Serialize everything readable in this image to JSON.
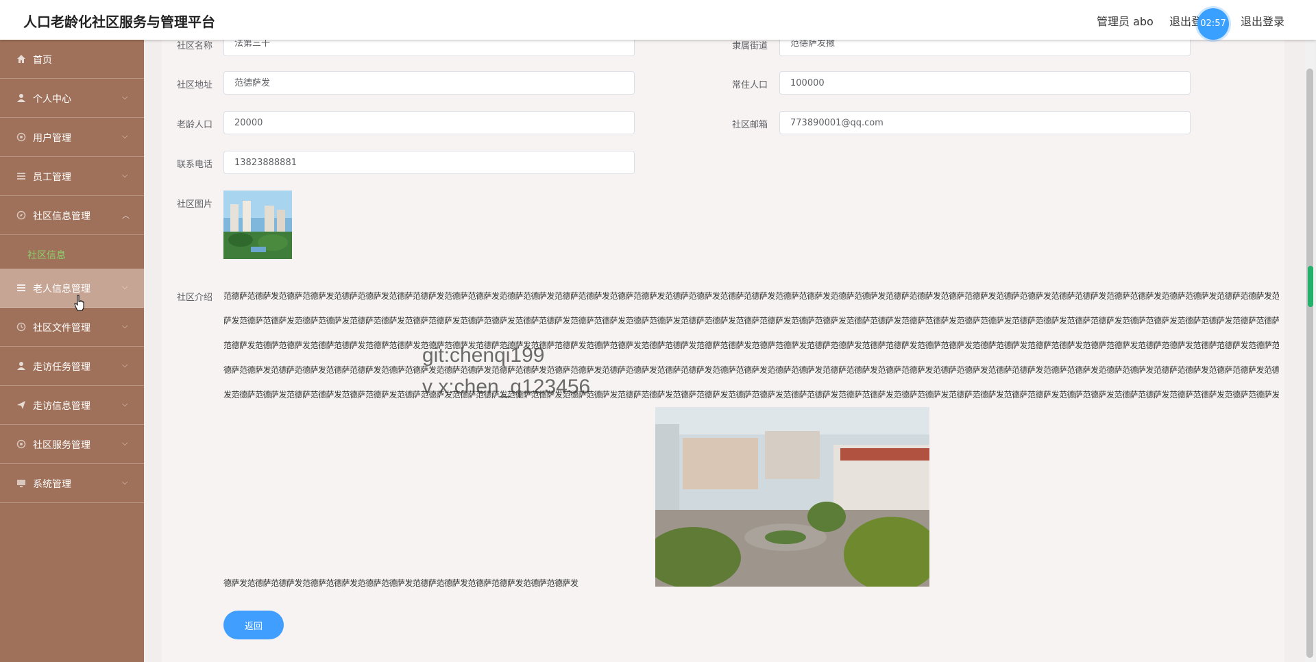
{
  "header": {
    "title": "人口老龄化社区服务与管理平台",
    "user": "管理员 abo",
    "logout_partial": "退出登",
    "timer": "02:57",
    "logout": "退出登录"
  },
  "sidebar": {
    "items": [
      {
        "label": "首页",
        "icon": "home-icon"
      },
      {
        "label": "个人中心",
        "icon": "user-icon"
      },
      {
        "label": "用户管理",
        "icon": "settings-icon"
      },
      {
        "label": "员工管理",
        "icon": "list-icon"
      },
      {
        "label": "社区信息管理",
        "icon": "compass-icon"
      },
      {
        "label": "老人信息管理",
        "icon": "menu-icon"
      },
      {
        "label": "社区文件管理",
        "icon": "clock-icon"
      },
      {
        "label": "走访任务管理",
        "icon": "user-icon"
      },
      {
        "label": "走访信息管理",
        "icon": "send-icon"
      },
      {
        "label": "社区服务管理",
        "icon": "settings-icon"
      },
      {
        "label": "系统管理",
        "icon": "monitor-icon"
      }
    ],
    "sub_item": "社区信息"
  },
  "form": {
    "community_name": {
      "label": "社区名称",
      "value": "法第三十"
    },
    "street": {
      "label": "隶属街道",
      "value": "范德萨发撒"
    },
    "address": {
      "label": "社区地址",
      "value": "范德萨发"
    },
    "population": {
      "label": "常住人口",
      "value": "100000"
    },
    "elderly": {
      "label": "老龄人口",
      "value": "20000"
    },
    "email": {
      "label": "社区邮箱",
      "value": "773890001@qq.com"
    },
    "phone": {
      "label": "联系电话",
      "value": "13823888881"
    },
    "image_label": "社区图片",
    "intro_label": "社区介绍",
    "intro_lines": [
      "范德萨范德萨发范德萨范德萨发范德萨范德萨发范德萨范德萨发范德萨范德萨发范德萨范德萨发范德萨范德萨发范德萨范德萨发范德萨范德萨发范德萨范德萨发范德萨范德萨发范德萨范德萨发范德萨范德萨发范德萨范德萨发范德萨范德萨发范德萨范德萨发范德萨范德萨发范德萨范德萨发范德萨范德萨发范德萨范德萨发范德",
      "萨发范德萨范德萨发范德萨范德萨发范德萨范德萨发范德萨范德萨发范德萨范德萨发范德萨范德萨发范德萨范德萨发范德萨范德萨发范德萨范德萨发范德萨范德萨发范德萨范德萨发范德萨范德萨发范德萨范德萨发范德萨范德萨发范德萨范德萨发范德萨范德萨发范德萨范德萨发范德萨范德萨发范德萨范德萨发范德萨范德",
      "范德萨发范德萨范德萨发范德萨范德萨发范德萨范德萨发范德萨范德萨发范德萨范德萨发范德萨范德萨发范德萨范德萨发范德萨范德萨发范德萨范德萨发范德萨范德萨发范德萨范德萨发范德萨范德萨发范德萨范德萨发范德萨范德萨发范德萨范德萨发范德萨范德萨发范德萨范德萨发范德萨范德萨发范德萨范德萨发范德萨范",
      "德萨范德萨发范德萨范德萨发范德萨范德萨发范德萨范德萨发范德萨范德萨发范德萨范德萨发范德萨范德萨发范德萨范德萨发范德萨范德萨发范德萨范德萨发范德萨范德萨发范德萨范德萨发范德萨范德萨发范德萨范德萨发范德萨范德萨发范德萨范德萨发范德萨范德萨发范德萨范德萨发范德萨范德萨发范德萨范德萨发范",
      "发范德萨范德萨发范德萨范德萨发范德萨范德萨发范德萨范德萨发范德萨范德萨发范德萨范德萨发范德萨范德萨发范德萨范德萨发范德萨范德萨发范德萨范德萨发范德萨范德萨发范德萨范德萨发范德萨范德萨发范德萨范德萨发范德萨范德萨发范德萨范德萨发范德萨范德萨发范德萨范德萨发范德萨范德萨发范德萨范德萨范"
    ],
    "intro_last_line": "德萨发范德萨范德萨发范德萨范德萨发范德萨范德萨发范德萨范德萨发范德萨范德萨发范德萨范德萨发",
    "back_button": "返回"
  },
  "watermark": {
    "line1": "git:chenqi199",
    "line2": "v x:chen_q123456"
  }
}
